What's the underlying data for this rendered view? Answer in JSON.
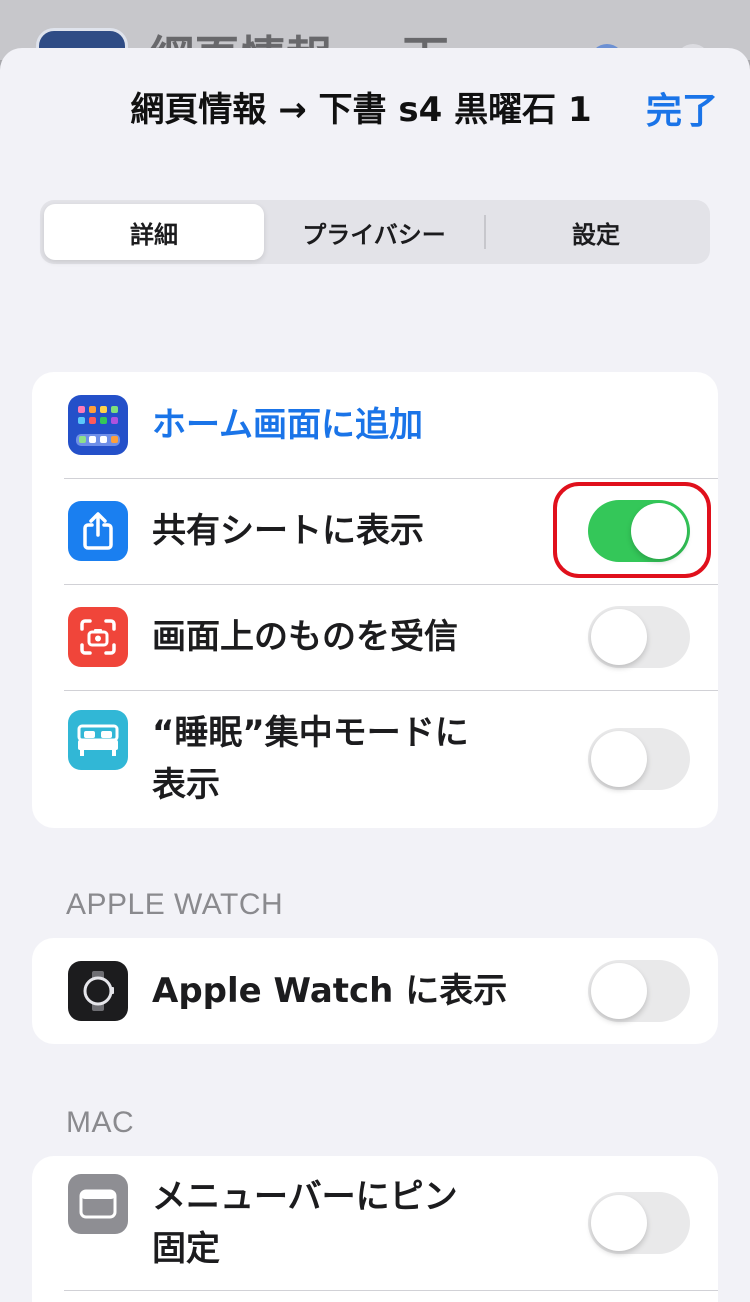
{
  "background": {
    "title": "網頁情報 → 下"
  },
  "nav": {
    "title": "網頁情報 → 下書 s4 黒曜石 1",
    "done_label": "完了"
  },
  "tabs": [
    {
      "label": "詳細",
      "active": true
    },
    {
      "label": "プライバシー",
      "active": false
    },
    {
      "label": "設定",
      "active": false
    }
  ],
  "main_group": {
    "add_home": {
      "label": "ホーム画面に追加",
      "icon": "home-grid-icon"
    },
    "share_sheet": {
      "label": "共有シートに表示",
      "icon": "share-icon",
      "enabled": true
    },
    "receive_onscreen": {
      "label": "画面上のものを受信",
      "icon": "screen-capture-icon",
      "enabled": false
    },
    "sleep_focus": {
      "label_line1": "“睡眠”集中モードに",
      "label_line2": "表示",
      "icon": "bed-icon",
      "enabled": false
    }
  },
  "watch_section": {
    "header": "APPLE WATCH",
    "show_on_watch": {
      "label": "Apple Watch に表示",
      "icon": "apple-watch-icon",
      "enabled": false
    }
  },
  "mac_section": {
    "header": "MAC",
    "pin_menubar": {
      "label_line1": "メニューバーにピン",
      "label_line2": "固定",
      "icon": "menubar-window-icon",
      "enabled": false
    }
  },
  "colors": {
    "accent": "#1a74e8",
    "toggle_on": "#34c759",
    "highlight": "#e0101c"
  }
}
